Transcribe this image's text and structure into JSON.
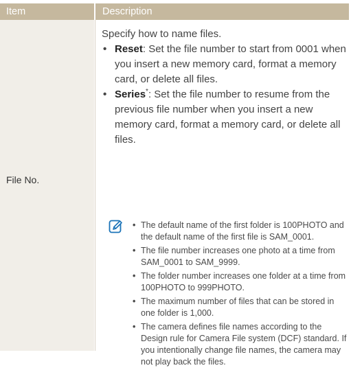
{
  "table": {
    "header_item": "Item",
    "header_description": "Description",
    "row_item": "File No."
  },
  "description": {
    "intro": "Specify how to name files.",
    "options": [
      {
        "name": "Reset",
        "text": ": Set the file number to start from 0001 when you insert a new memory card, format a memory card, or delete all files."
      },
      {
        "name": "Series",
        "mark": "*",
        "text": ": Set the file number to resume from the previous file number when you insert a new memory card, format a memory card, or delete all files."
      }
    ]
  },
  "notes": [
    "The default name of the first folder is 100PHOTO and the default name of the first file is SAM_0001.",
    "The file number increases one photo at a time from SAM_0001 to SAM_9999.",
    "The folder number increases one folder at a time from 100PHOTO to 999PHOTO.",
    "The maximum number of files that can be stored in one folder is 1,000.",
    "The camera defines file names according to the Design rule for Camera File system (DCF) standard. If you intentionally change file names, the camera may not play back the files."
  ],
  "icons": {
    "note": "note-pencil-icon",
    "bullet": "bullet-dot"
  },
  "colors": {
    "header_bg": "#c5b89e",
    "left_column_bg": "#f1eee8",
    "icon_blue": "#1a73b8"
  }
}
